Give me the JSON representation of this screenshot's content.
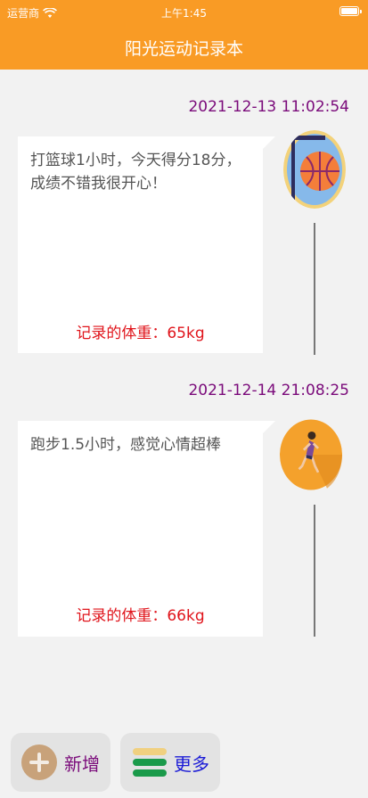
{
  "status": {
    "carrier": "运营商",
    "time": "上午1:45"
  },
  "header": {
    "title": "阳光运动记录本"
  },
  "entries": [
    {
      "timestamp": "2021-12-13 11:02:54",
      "text": "打篮球1小时，今天得分18分，成绩不错我很开心！",
      "weight": "记录的体重：65kg",
      "icon": "basketball-hoop-icon"
    },
    {
      "timestamp": "2021-12-14 21:08:25",
      "text": "跑步1.5小时，感觉心情超棒",
      "weight": "记录的体重：66kg",
      "icon": "runner-icon"
    }
  ],
  "toolbar": {
    "add_label": "新增",
    "more_label": "更多"
  },
  "colors": {
    "header": "#f99b25",
    "timestamp": "#7a0a7a",
    "weight": "#e0141b",
    "more": "#1a1ad6",
    "add": "#7a0a7a"
  }
}
